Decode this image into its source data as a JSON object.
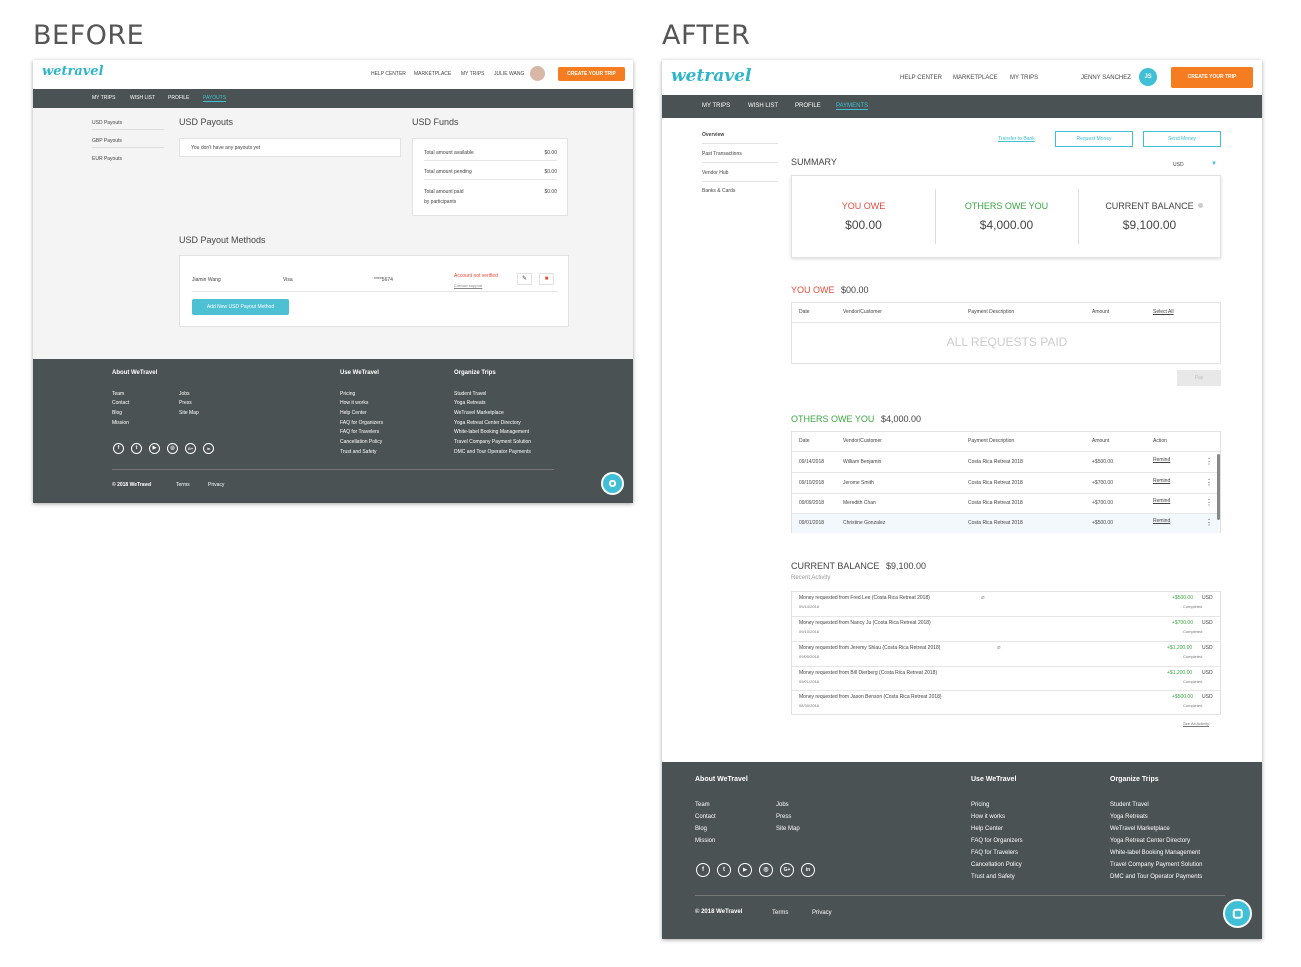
{
  "labels": {
    "before": "BEFORE",
    "after": "AFTER"
  },
  "brand": {
    "logo": "wetravel",
    "accent": "#3fc0d6",
    "orange": "#f57c20",
    "dark": "#4b5253"
  },
  "before": {
    "topnav": [
      "HELP CENTER",
      "MARKETPLACE",
      "MY TRIPS",
      "JULIE WANG"
    ],
    "cta": "CREATE YOUR TRIP",
    "subnav": [
      "MY TRIPS",
      "WISH LIST",
      "PROFILE",
      "PAYOUTS"
    ],
    "sidebar": [
      "USD Payouts",
      "GBP Payouts",
      "EUR Payouts"
    ],
    "usd_payouts": {
      "title": "USD Payouts",
      "empty": "You don't have any payouts yet"
    },
    "usd_funds": {
      "title": "USD Funds",
      "rows": [
        {
          "label": "Total amount available",
          "value": "$0.00"
        },
        {
          "label": "Total amount pending",
          "value": "$0.00"
        },
        {
          "label": "Total amount paid",
          "label2": "by participants",
          "value": "$0.00"
        }
      ]
    },
    "methods": {
      "title": "USD Payout Methods",
      "name": "Jiamin Wang",
      "type": "Visa",
      "number": "****5674",
      "status": "Account not verified",
      "contact": "Contact support",
      "add": "Add New USD Payout Method"
    }
  },
  "after": {
    "topnav": [
      "HELP CENTER",
      "MARKETPLACE",
      "MY TRIPS",
      "JENNY SANCHEZ"
    ],
    "avatar": "JS",
    "cta": "CREATE YOUR TRIP",
    "subnav": [
      "MY TRIPS",
      "WISH LIST",
      "PROFILE",
      "PAYMENTS"
    ],
    "sidebar": [
      "Overview",
      "Past Transactions",
      "Vendor Hub",
      "Banks & Cards"
    ],
    "actions": {
      "transfer": "Transfer to Bank",
      "request": "Request Money",
      "send": "Send Money"
    },
    "summary": {
      "title": "SUMMARY",
      "currency": "USD",
      "cards": [
        {
          "label": "YOU OWE",
          "value": "$00.00"
        },
        {
          "label": "OTHERS OWE YOU",
          "value": "$4,000.00"
        },
        {
          "label": "CURRENT BALANCE",
          "value": "$9,100.00"
        }
      ]
    },
    "you_owe": {
      "title": "YOU OWE",
      "amount": "$00.00",
      "headers": [
        "Date",
        "Vendor/Customer",
        "Payment Description",
        "Amount",
        "Select All"
      ],
      "empty": "ALL REQUESTS PAID",
      "pay": "Pay"
    },
    "others_owe": {
      "title": "OTHERS OWE YOU",
      "amount": "$4,000.00",
      "headers": [
        "Date",
        "Vendor/Customer",
        "Payment Description",
        "Amount",
        "Action"
      ],
      "rows": [
        {
          "date": "09/14/2018",
          "name": "William Benjamin",
          "desc": "Costa Rica Retreat 2018",
          "amount": "+$500.00",
          "action": "Remind"
        },
        {
          "date": "09/10/2018",
          "name": "Jerome Smith",
          "desc": "Costa Rica Retreat 2018",
          "amount": "+$700.00",
          "action": "Remind"
        },
        {
          "date": "09/09/2018",
          "name": "Meredith Chan",
          "desc": "Costa Rica Retreat 2018",
          "amount": "+$700.00",
          "action": "Remind"
        },
        {
          "date": "09/01/2018",
          "name": "Christine Gonzalez",
          "desc": "Costa Rica Retreat 2018",
          "amount": "+$500.00",
          "action": "Remind"
        }
      ]
    },
    "balance": {
      "title": "CURRENT BALANCE",
      "amount": "$9,100.00",
      "subtitle": "Recent Activity",
      "see_all": "See All Activity",
      "rows": [
        {
          "text": "Money requested from Fred Lee (Costa Rica Retreat 2018)",
          "date": "09/14/2018",
          "amount": "+$500.00",
          "cur": "USD",
          "status": "Completed"
        },
        {
          "text": "Money requested from Nancy Ju (Costa Rica Retreat 2018)",
          "date": "09/10/2018",
          "amount": "+$700.00",
          "cur": "USD",
          "status": "Completed"
        },
        {
          "text": "Money requested from Jeremy Shiau (Costa Rica Retreat 2018)",
          "date": "09/05/2018",
          "amount": "+$1,200.00",
          "cur": "USD",
          "status": "Completed"
        },
        {
          "text": "Money requested from Bill Dierberg (Costa Rica Retreat 2018)",
          "date": "09/01/2018",
          "amount": "+$1,200.00",
          "cur": "USD",
          "status": "Completed"
        },
        {
          "text": "Money requested from Jason Benson (Costa Rica Retreat 2018)",
          "date": "08/30/2018",
          "amount": "+$500.00",
          "cur": "USD",
          "status": "Completed"
        }
      ]
    }
  },
  "footer": {
    "about": "About WeTravel",
    "use": "Use WeTravel",
    "organize": "Organize Trips",
    "about_col1": [
      "Team",
      "Contact",
      "Blog",
      "Mission"
    ],
    "about_col2": [
      "Jobs",
      "Press",
      "Site Map"
    ],
    "use_links": [
      "Pricing",
      "How it works",
      "Help Center",
      "FAQ for Organizers",
      "FAQ for Travelers",
      "Cancellation Policy",
      "Trust and Safety"
    ],
    "organize_links": [
      "Student Travel",
      "Yoga Retreats",
      "WeTravel Marketplace",
      "Yoga Retreat Center Directory",
      "White-label Booking Management",
      "Travel Company Payment Solution",
      "DMC and Tour Operator Payments"
    ],
    "social": [
      "f",
      "t",
      "▶",
      "◎",
      "G+",
      "in"
    ],
    "copyright": "© 2018 WeTravel",
    "terms": "Terms",
    "privacy": "Privacy"
  }
}
